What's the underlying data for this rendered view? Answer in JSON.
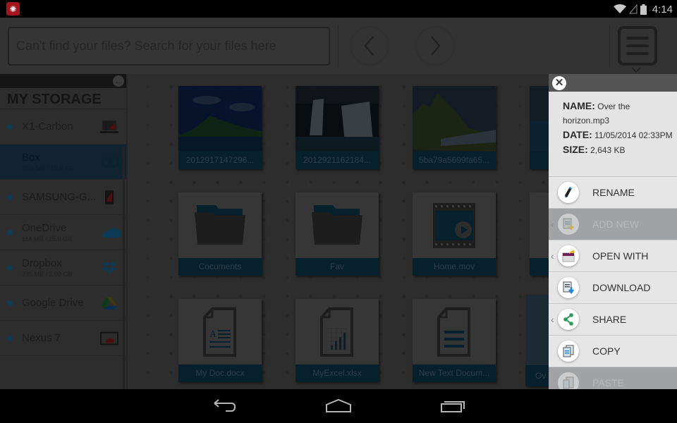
{
  "status_bar": {
    "app_icon": "virus-badge-icon",
    "icons": [
      "wifi-icon",
      "no-signal-icon",
      "battery-icon"
    ],
    "time": "4:14"
  },
  "toolbar": {
    "search_placeholder": "Can't find your files? Search for your files here",
    "back_icon": "chevron-left-icon",
    "forward_icon": "chevron-right-icon",
    "menu_icon": "hamburger-menu-icon"
  },
  "sidebar": {
    "title": "MY STORAGE",
    "collapse_icon": "arrow-left-circle-icon",
    "items": [
      {
        "name": "X1-Carbon",
        "sub": "",
        "icon": "laptop-icon"
      },
      {
        "name": "Box",
        "sub": "31.5 MB / 10.0 GB",
        "icon": "box-icon",
        "active": true
      },
      {
        "name": "SAMSUNG-G...",
        "sub": "",
        "icon": "phone-icon"
      },
      {
        "name": "OneDrive",
        "sub": "114 MB / 15.0 GB",
        "icon": "cloud-icon"
      },
      {
        "name": "Dropbox",
        "sub": "235 MB / 2.00 GB",
        "icon": "dropbox-icon"
      },
      {
        "name": "Google Drive",
        "sub": "",
        "icon": "google-drive-icon"
      },
      {
        "name": "Nexus 7",
        "sub": "",
        "icon": "tablet-icon"
      }
    ]
  },
  "files": [
    {
      "name": "2012917147296...",
      "type": "image",
      "icon": "island-photo"
    },
    {
      "name": "2012921162184...",
      "type": "image",
      "icon": "waterfall-photo"
    },
    {
      "name": "5ba79a5699fa65...",
      "type": "image",
      "icon": "mountain-photo"
    },
    {
      "name": "",
      "type": "image",
      "icon": "ocean-photo"
    },
    {
      "name": "Cocuments",
      "type": "folder",
      "icon": "folder-icon"
    },
    {
      "name": "Fav",
      "type": "folder",
      "icon": "folder-icon"
    },
    {
      "name": "Home.mov",
      "type": "video",
      "icon": "video-icon"
    },
    {
      "name": "",
      "type": "partial",
      "icon": "file-icon"
    },
    {
      "name": "My Doc.docx",
      "type": "doc",
      "icon": "word-doc-icon"
    },
    {
      "name": "MyExcel.xlsx",
      "type": "xls",
      "icon": "excel-doc-icon"
    },
    {
      "name": "New Text Docum...",
      "type": "txt",
      "icon": "text-doc-icon"
    },
    {
      "name": "Ov",
      "type": "selected",
      "icon": "audio-icon"
    }
  ],
  "details": {
    "name_label": "NAME:",
    "name_value": "Over the horizon.mp3",
    "date_label": "DATE:",
    "date_value": "11/05/2014 02:33PM",
    "size_label": "SIZE:",
    "size_value": "2,643 KB",
    "close_icon": "close-circle-icon"
  },
  "actions": [
    {
      "label": "RENAME",
      "icon": "pencil-icon",
      "enabled": true,
      "submenu": false
    },
    {
      "label": "ADD NEW",
      "icon": "add-file-icon",
      "enabled": false,
      "submenu": true
    },
    {
      "label": "OPEN WITH",
      "icon": "open-with-icon",
      "enabled": true,
      "submenu": true
    },
    {
      "label": "DOWNLOAD",
      "icon": "download-icon",
      "enabled": true,
      "submenu": false
    },
    {
      "label": "SHARE",
      "icon": "share-icon",
      "enabled": true,
      "submenu": true
    },
    {
      "label": "COPY",
      "icon": "copy-icon",
      "enabled": true,
      "submenu": false
    },
    {
      "label": "PASTE",
      "icon": "paste-icon",
      "enabled": false,
      "submenu": false
    }
  ],
  "nav_bar": {
    "back": "back-icon",
    "home": "home-icon",
    "recents": "recents-icon"
  }
}
